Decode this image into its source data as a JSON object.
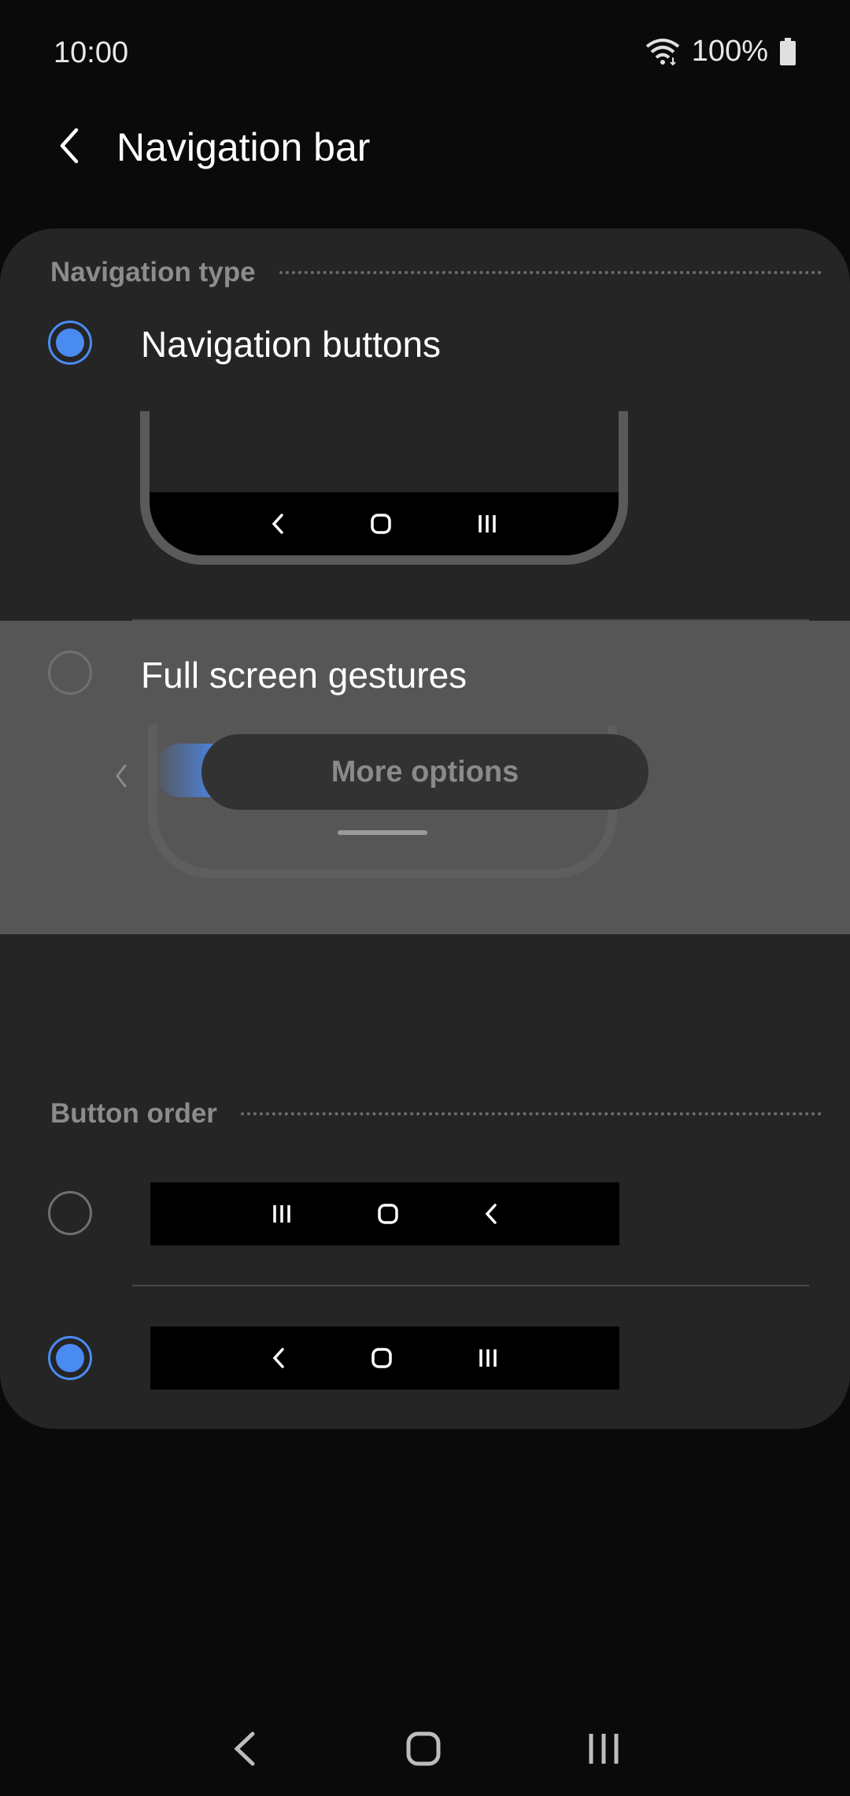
{
  "status_bar": {
    "time": "10:00",
    "battery_percent": "100%",
    "icons": [
      "wifi-icon",
      "battery-icon"
    ]
  },
  "header": {
    "title": "Navigation bar",
    "back_icon": "chevron-left-icon"
  },
  "navigation_type": {
    "section_title": "Navigation type",
    "options": [
      {
        "label": "Navigation buttons",
        "selected": true
      },
      {
        "label": "Full screen gestures",
        "selected": false
      }
    ]
  },
  "more_options": {
    "label": "More options"
  },
  "button_order": {
    "section_title": "Button order",
    "options": [
      {
        "order": [
          "recents-icon",
          "home-icon",
          "back-icon"
        ],
        "selected": false
      },
      {
        "order": [
          "back-icon",
          "home-icon",
          "recents-icon"
        ],
        "selected": true
      }
    ]
  },
  "colors": {
    "accent": "#4a8bf2",
    "card": "#252525",
    "highlight": "#565656"
  }
}
